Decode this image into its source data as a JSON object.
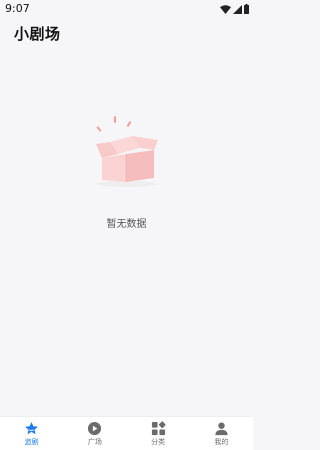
{
  "status_bar": {
    "time": "9:07"
  },
  "header": {
    "title": "小剧场"
  },
  "empty_state": {
    "message": "暂无数据"
  },
  "colors": {
    "accent": "#1e7bf0",
    "inactive": "#6b6b6b",
    "background": "#f6f6f8"
  },
  "tabs": [
    {
      "label": "追剧",
      "icon": "star-icon",
      "active": true
    },
    {
      "label": "广场",
      "icon": "play-circle-icon",
      "active": false
    },
    {
      "label": "分类",
      "icon": "category-grid-icon",
      "active": false
    },
    {
      "label": "我的",
      "icon": "person-icon",
      "active": false
    }
  ]
}
